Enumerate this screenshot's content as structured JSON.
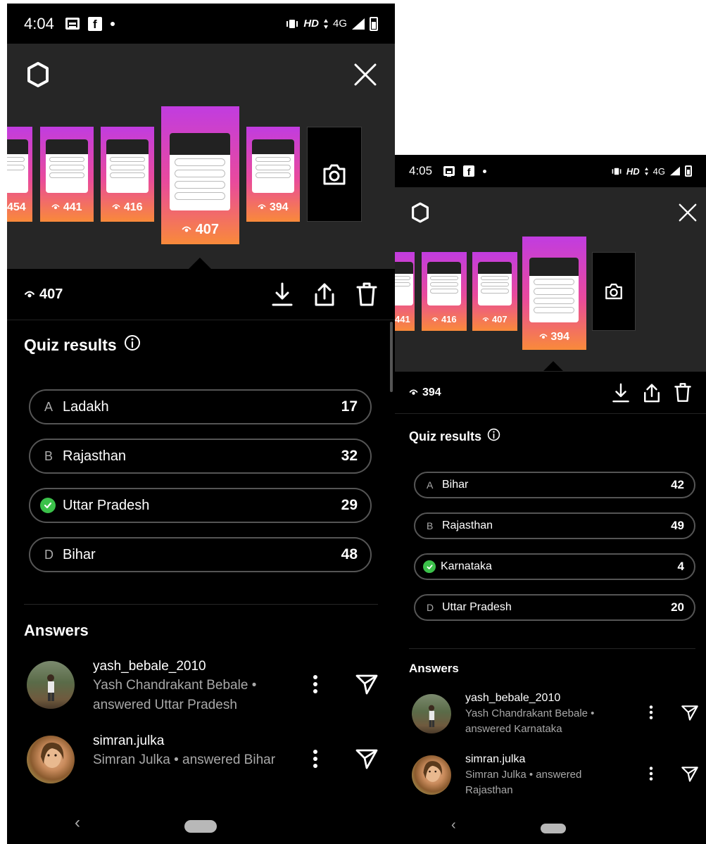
{
  "left": {
    "status": {
      "time": "4:04",
      "network": "HD",
      "signal": "4G"
    },
    "stories": [
      {
        "views": "454"
      },
      {
        "views": "441"
      },
      {
        "views": "416"
      },
      {
        "views": "407"
      },
      {
        "views": "394"
      }
    ],
    "selected_views": "407",
    "quiz_title": "Quiz results",
    "options": [
      {
        "letter": "A",
        "label": "Ladakh",
        "count": "17",
        "correct": false
      },
      {
        "letter": "B",
        "label": "Rajasthan",
        "count": "32",
        "correct": false
      },
      {
        "letter": "",
        "label": "Uttar Pradesh",
        "count": "29",
        "correct": true
      },
      {
        "letter": "D",
        "label": "Bihar",
        "count": "48",
        "correct": false
      }
    ],
    "answers_title": "Answers",
    "answers": [
      {
        "username": "yash_bebale_2010",
        "description": "Yash Chandrakant Bebale • answered Uttar Pradesh"
      },
      {
        "username": "simran.julka",
        "description": "Simran Julka • answered Bihar"
      }
    ],
    "nav_back": "‹"
  },
  "right": {
    "status": {
      "time": "4:05",
      "network": "HD",
      "signal": "4G"
    },
    "stories": [
      {
        "views": "441"
      },
      {
        "views": "416"
      },
      {
        "views": "407"
      },
      {
        "views": "394"
      }
    ],
    "selected_views": "394",
    "quiz_title": "Quiz results",
    "options": [
      {
        "letter": "A",
        "label": "Bihar",
        "count": "42",
        "correct": false
      },
      {
        "letter": "B",
        "label": "Rajasthan",
        "count": "49",
        "correct": false
      },
      {
        "letter": "",
        "label": "Karnataka",
        "count": "4",
        "correct": true
      },
      {
        "letter": "D",
        "label": "Uttar Pradesh",
        "count": "20",
        "correct": false
      }
    ],
    "answers_title": "Answers",
    "answers": [
      {
        "username": "yash_bebale_2010",
        "description": "Yash Chandrakant Bebale • answered Karnataka"
      },
      {
        "username": "simran.julka",
        "description": "Simran Julka • answered Rajasthan"
      }
    ],
    "nav_back": "‹"
  },
  "icons": {
    "settings": "settings-ring-icon",
    "close": "close-icon",
    "camera": "camera-icon",
    "eye": "eye-icon",
    "download": "download-icon",
    "share": "share-icon",
    "delete": "trash-icon",
    "info": "info-icon",
    "check": "check-circle-icon",
    "more": "more-vertical-icon",
    "send": "send-icon"
  },
  "colors": {
    "background": "#000000",
    "viewer_bg": "#262626",
    "correct": "#3bc14a",
    "story_gradient_top": "#c13ce0",
    "story_gradient_bottom": "#f98a3a"
  }
}
